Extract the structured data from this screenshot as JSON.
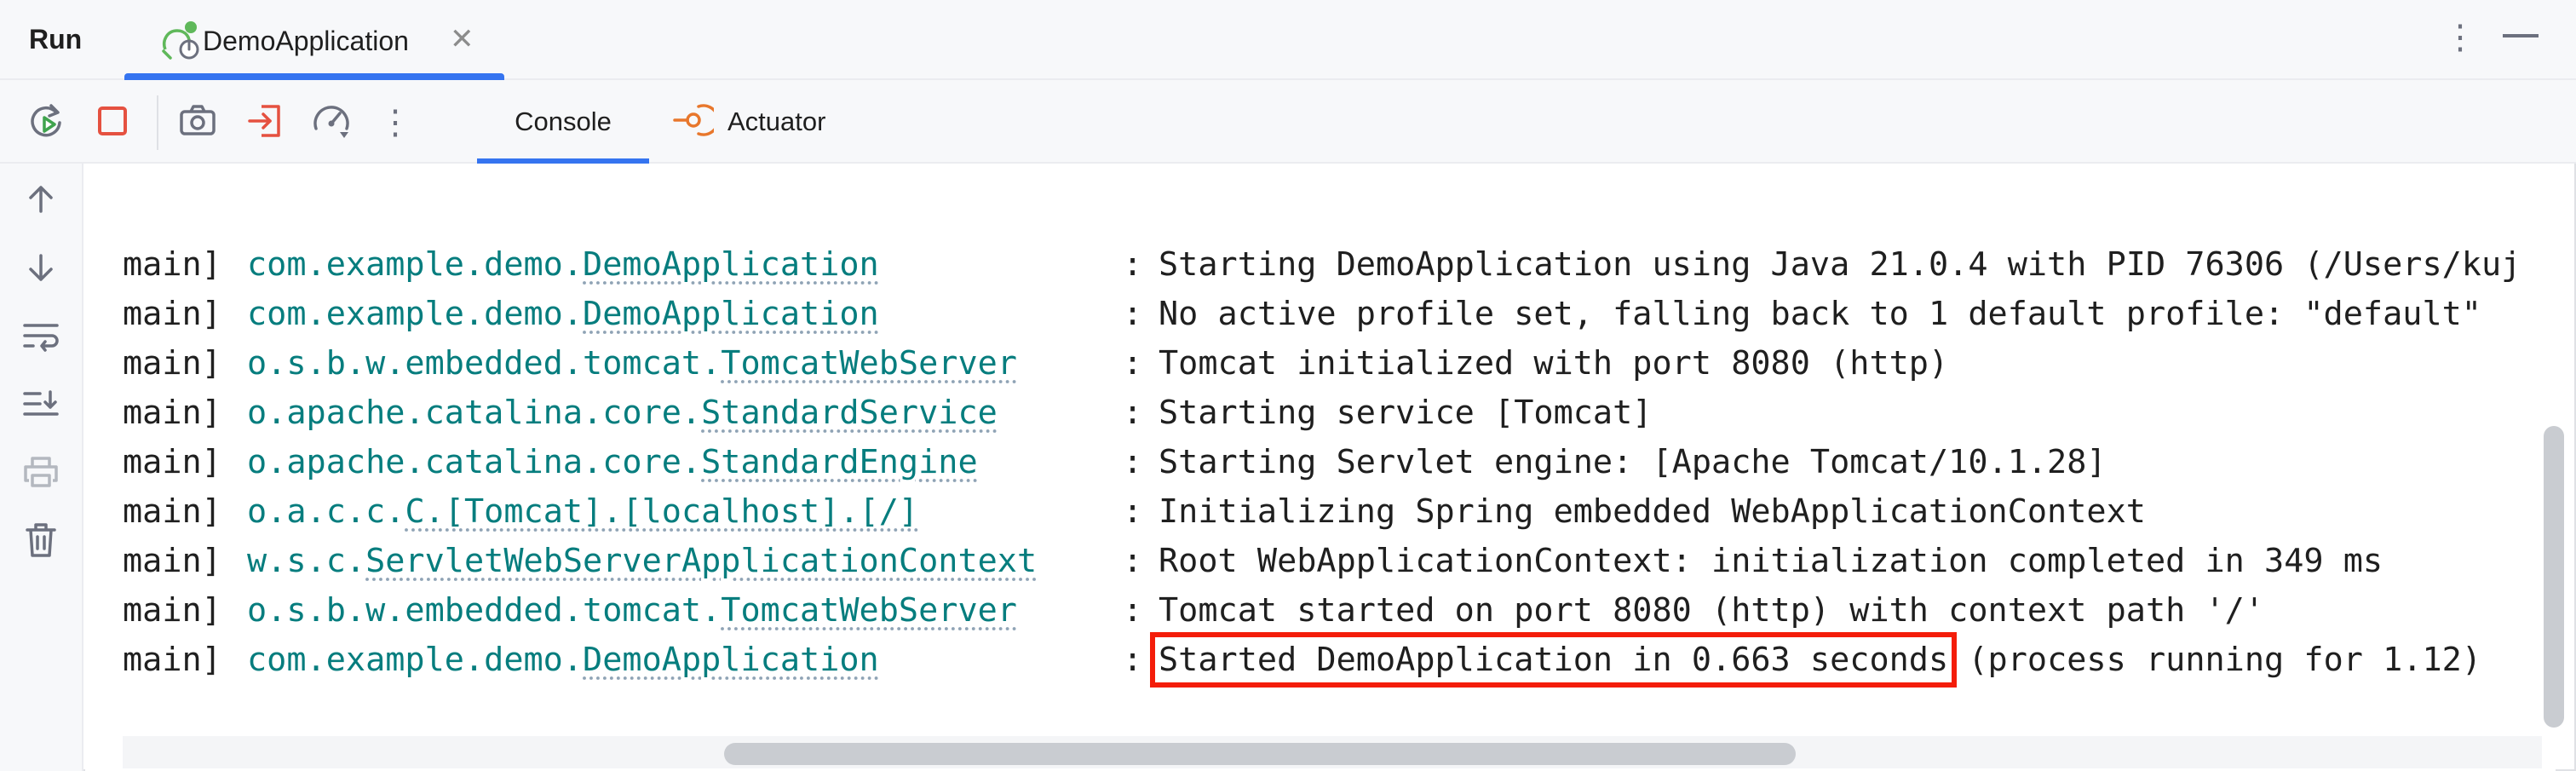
{
  "window": {
    "tool_title": "Run",
    "run_tab": {
      "label": "DemoApplication",
      "close": "✕"
    },
    "more_label": "⋮"
  },
  "toolbar": {
    "buttons": [
      "rerun-icon",
      "stop-icon",
      "camera-icon",
      "exit-icon",
      "gauge-icon",
      "more-vertical-icon"
    ],
    "more_label": "⋮",
    "tabs": [
      {
        "label": "Console",
        "active": true
      },
      {
        "label": "Actuator",
        "active": false
      }
    ]
  },
  "gutter": {
    "buttons": [
      "arrow-up-icon",
      "arrow-down-icon",
      "soft-wrap-icon",
      "scroll-to-end-icon",
      "print-icon",
      "trash-icon"
    ]
  },
  "colors": {
    "accent": "#3574f0",
    "logger": "#067d7e",
    "highlight_box": "#f41d0a",
    "stop": "#e55140",
    "actuator": "#e8772c"
  },
  "console": {
    "lines": [
      {
        "thread": "main]",
        "pkg": "com.example.demo.",
        "cls": "DemoApplication",
        "colon": ":",
        "message": "Starting DemoApplication using Java 21.0.4 with PID 76306 (/Users/kuj"
      },
      {
        "thread": "main]",
        "pkg": "com.example.demo.",
        "cls": "DemoApplication",
        "colon": ":",
        "message": "No active profile set, falling back to 1 default profile: \"default\""
      },
      {
        "thread": "main]",
        "pkg": "o.s.b.w.embedded.tomcat.",
        "cls": "TomcatWebServer",
        "colon": ":",
        "message": "Tomcat initialized with port 8080 (http)"
      },
      {
        "thread": "main]",
        "pkg": "o.apache.catalina.core.",
        "cls": "StandardService",
        "colon": ":",
        "message": "Starting service [Tomcat]"
      },
      {
        "thread": "main]",
        "pkg": "o.apache.catalina.core.",
        "cls": "StandardEngine",
        "colon": ":",
        "message": "Starting Servlet engine: [Apache Tomcat/10.1.28]"
      },
      {
        "thread": "main]",
        "pkg": "o.a.c.c.",
        "cls": "C.[Tomcat].[localhost].[/]",
        "colon": ":",
        "message": "Initializing Spring embedded WebApplicationContext"
      },
      {
        "thread": "main]",
        "pkg": "w.s.c.",
        "cls": "ServletWebServerApplicationContext",
        "colon": ":",
        "message": "Root WebApplicationContext: initialization completed in 349 ms"
      },
      {
        "thread": "main]",
        "pkg": "o.s.b.w.embedded.tomcat.",
        "cls": "TomcatWebServer",
        "colon": ":",
        "message": "Tomcat started on port 8080 (http) with context path '/'"
      },
      {
        "thread": "main]",
        "pkg": "com.example.demo.",
        "cls": "DemoApplication",
        "colon": ":",
        "message_highlight": "Started DemoApplication in 0.663 seconds",
        "message_rest": " (process running for 1.12)"
      }
    ]
  }
}
